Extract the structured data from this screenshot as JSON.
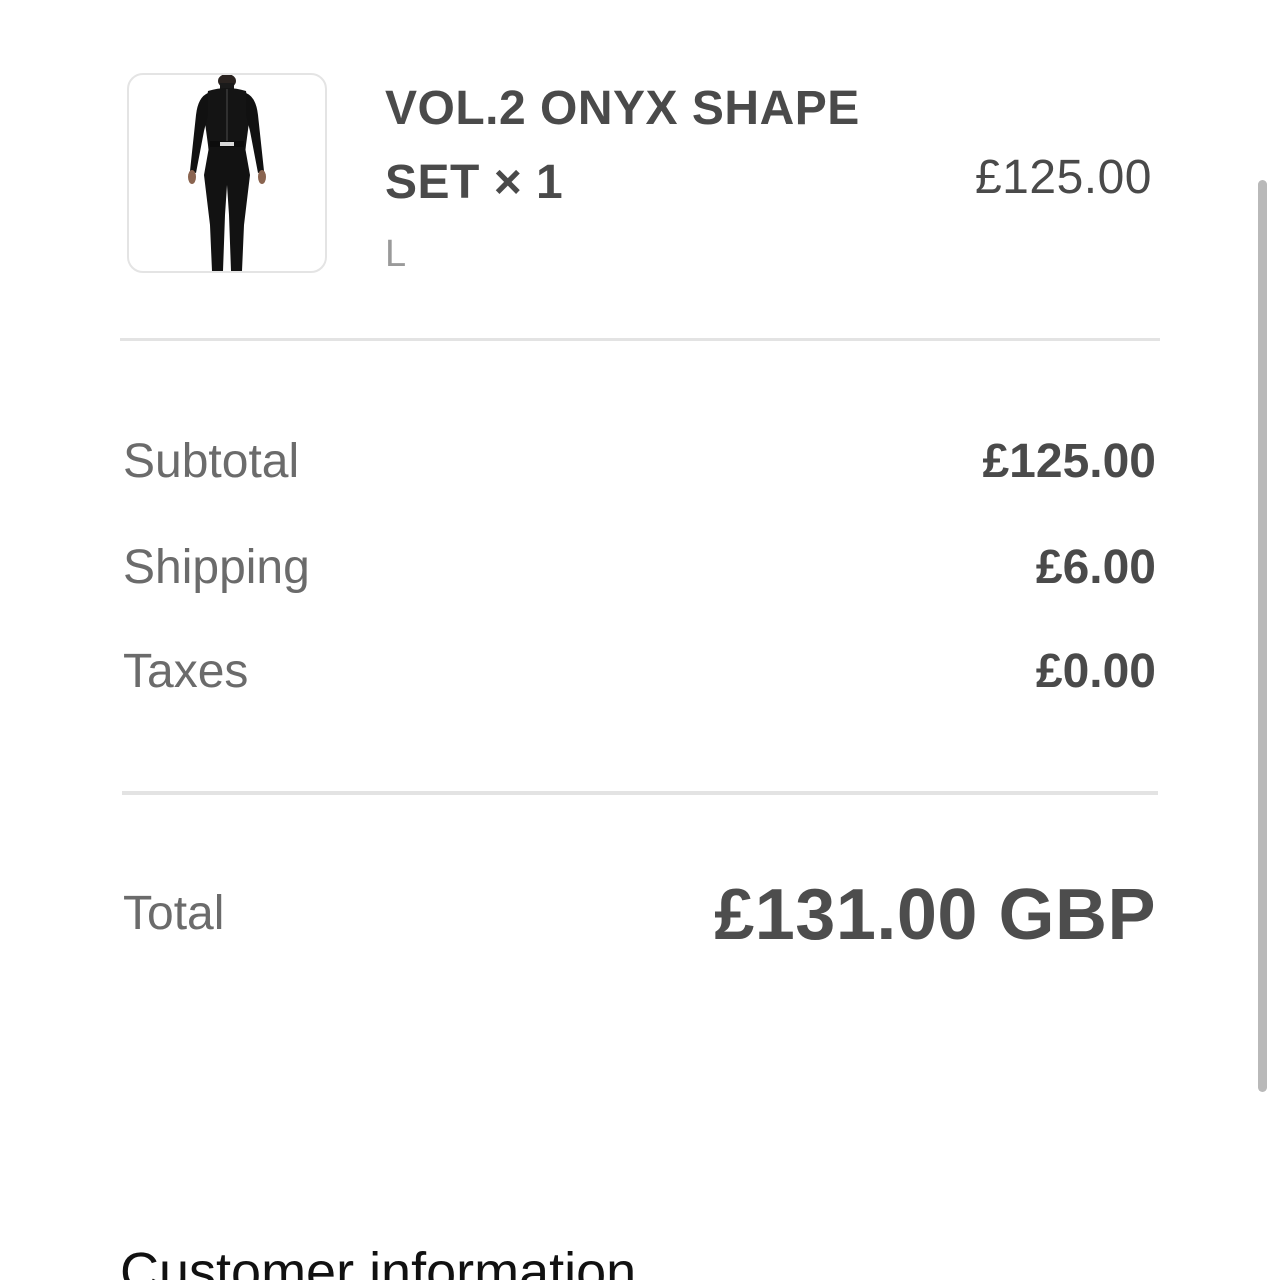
{
  "order": {
    "item": {
      "name": "VOL.2 ONYX SHAPE SET × 1",
      "variant": "L",
      "price": "£125.00",
      "image_icon": "black-bodysuit-product-image"
    },
    "summary": {
      "subtotal_label": "Subtotal",
      "subtotal_value": "£125.00",
      "shipping_label": "Shipping",
      "shipping_value": "£6.00",
      "taxes_label": "Taxes",
      "taxes_value": "£0.00",
      "total_label": "Total",
      "total_value": "£131.00 GBP"
    }
  },
  "next_section": {
    "title": "Customer information"
  },
  "colors": {
    "text_primary": "#4a4a4a",
    "text_secondary": "#6b6b6b",
    "text_muted": "#9a9a9a",
    "divider": "#e3e3e3",
    "heading": "#111111"
  }
}
